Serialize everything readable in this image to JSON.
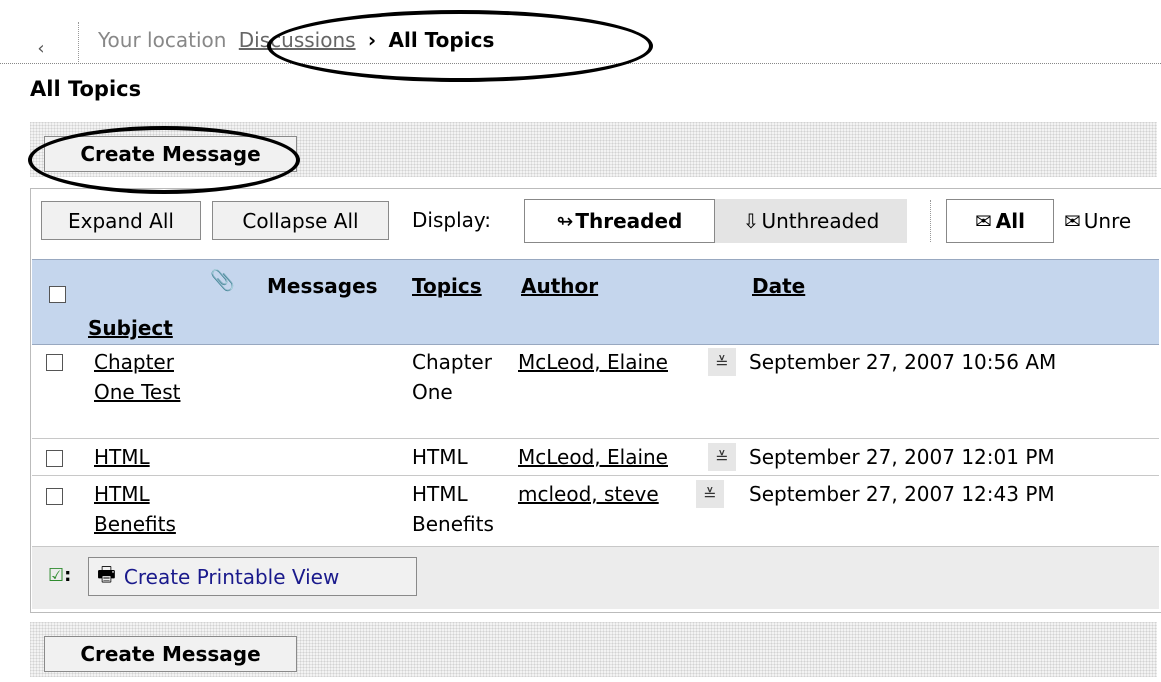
{
  "breadcrumb": {
    "label": "Your location",
    "link": "Discussions",
    "separator": "›",
    "current": "All Topics"
  },
  "page": {
    "title": "All Topics"
  },
  "actions": {
    "create_message": "Create Message"
  },
  "toolbar": {
    "expand_all": "Expand All",
    "collapse_all": "Collapse All",
    "display_label": "Display:",
    "threaded": "Threaded",
    "unthreaded": "Unthreaded",
    "filter_all": "All",
    "filter_unread": "Unre"
  },
  "table": {
    "headers": {
      "messages": "Messages",
      "topics": "Topics",
      "author": "Author",
      "date": "Date",
      "subject": "Subject"
    },
    "rows": [
      {
        "subject": "Chapter One Test",
        "topic": "Chapter One",
        "author": "McLeod, Elaine",
        "date": "September 27, 2007 10:56 AM"
      },
      {
        "subject": "HTML",
        "topic": "HTML",
        "author": "McLeod, Elaine",
        "date": "September 27, 2007 12:01 PM"
      },
      {
        "subject": "HTML Benefits",
        "topic": "HTML Benefits",
        "author": "mcleod, steve",
        "date": "September 27, 2007 12:43 PM"
      }
    ],
    "footer": {
      "check_label": ":",
      "printable_view": "Create Printable View"
    }
  },
  "icons": {
    "back": "chevron-left-icon",
    "attachment": "paperclip-icon",
    "threaded": "threaded-arrow-icon",
    "unthreaded": "down-arrow-icon",
    "all": "envelopes-icon",
    "unread": "envelope-icon",
    "author_menu": "context-menu-icon",
    "print": "printer-icon",
    "check": "checkbox-checked-icon"
  }
}
